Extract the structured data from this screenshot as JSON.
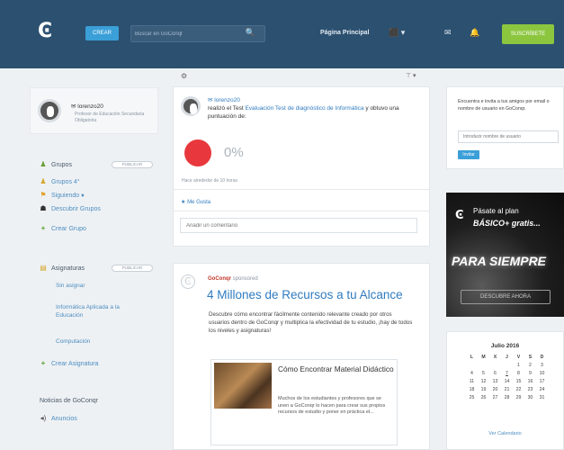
{
  "topbar": {
    "logo": "Ͼ",
    "create_label": "CREAR",
    "search_placeholder": "Buscar en GoConqr",
    "search_icon": "🔍",
    "home_label": "Página Principal",
    "user_menu": "⬛ ▾",
    "messages_icon": "✉",
    "notifications_icon": "🔔",
    "premium_label": "SUSCRÍBETE"
  },
  "profile": {
    "name": "lorenzo20",
    "subtitle": "Profesor de Educación Secundaria Obligatoria"
  },
  "sidebar": {
    "groups_label": "Grupos",
    "groups_pill": "PUBLICAR",
    "group_items": [
      {
        "icon": "♟",
        "label": "Grupos 4°"
      },
      {
        "icon": "⚑",
        "label": "Siguiendo ♦"
      },
      {
        "icon": "☗",
        "label": "Descubrir Grupos"
      },
      {
        "icon": "+",
        "label": "Crear Grupo"
      }
    ],
    "subjects_label": "Asignaturas",
    "subjects_pill": "PUBLICAR",
    "subject_items": [
      "Sin asignar",
      "Informática Aplicada a la Educación",
      "Computación"
    ],
    "create_subject": "Crear Asignatura",
    "news_label": "Noticias de GoConqr",
    "news_item": "Anuncios"
  },
  "feed_toolbar": {
    "left_icon": "⚙",
    "right_icon": "⊤ ▾"
  },
  "activity": {
    "user": "lorenzo20",
    "text_before": "realizó el Test ",
    "test_link": "Evaluación Test de diagnóstico de Informática",
    "text_after": " y obtuvo una puntuación de:",
    "score": "0%",
    "meta": "Hace alrededor de 10 horas",
    "like_label": "Me Gusta",
    "comment_placeholder": "Añadir un comentario"
  },
  "sponsored": {
    "brand": "GoConqr",
    "tag": "sponsored",
    "title": "4 Millones de Recursos a tu Alcance",
    "body": "Descubre cómo encontrar fácilmente contenido relevante creado por otros usuarios dentro de GoConqr y multiplica la efectividad de tu estudio, ¡hay de todos los niveles y asignaturas!",
    "card_title": "Cómo Encontrar Material Didáctico",
    "card_body": "Muchos de los estudiantes y profesores que se unen a GoConqr lo hacen para crear sus propios recursos de estudio y poner en práctica el..."
  },
  "find_friends": {
    "text": "Encuentra e invita a tus amigos por email o nombre de usuario en GoConqr.",
    "placeholder": "Introducir nombre de usuario",
    "button": "Invitar"
  },
  "banner": {
    "logo": "Ͼ",
    "line1": "Pásate al plan",
    "line2": "BÁSICO+ gratis...",
    "big": "PARA SIEMPRE",
    "cta": "DESCUBRE AHORA"
  },
  "calendar": {
    "title": "Julio 2016",
    "days": [
      "L",
      "M",
      "X",
      "J",
      "V",
      "S",
      "D"
    ],
    "dates": [
      "",
      "",
      "",
      "",
      "1",
      "2",
      "3",
      "4",
      "5",
      "6",
      "7",
      "8",
      "9",
      "10",
      "11",
      "12",
      "13",
      "14",
      "15",
      "16",
      "17",
      "18",
      "19",
      "20",
      "21",
      "22",
      "23",
      "24",
      "25",
      "26",
      "27",
      "28",
      "29",
      "30",
      "31"
    ],
    "link": "Ver Calendario"
  },
  "colors": {
    "topbar": "#2c5070",
    "accent_blue": "#2f7bbf",
    "premium_green": "#8cc63f",
    "score_red": "#e8383d"
  }
}
